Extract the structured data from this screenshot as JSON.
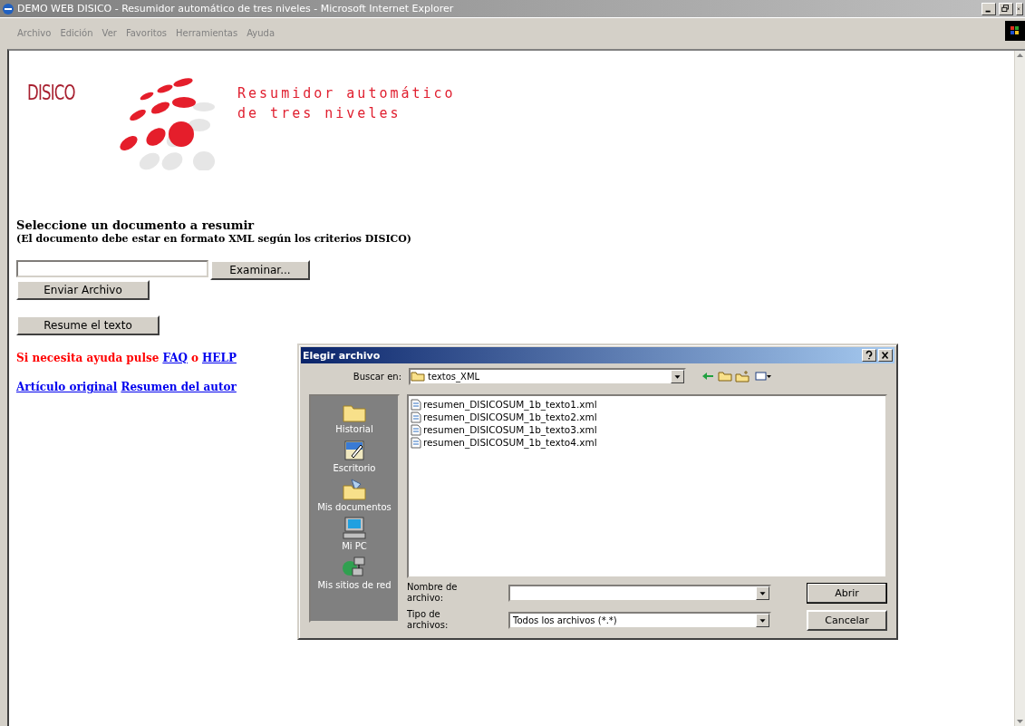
{
  "window": {
    "title": "DEMO WEB DISICO - Resumidor automático de tres niveles - Microsoft Internet Explorer"
  },
  "menu": [
    "Archivo",
    "Edición",
    "Ver",
    "Favoritos",
    "Herramientas",
    "Ayuda"
  ],
  "logo": {
    "brand": "DISICO",
    "title_lines": [
      "Resumidor automático",
      "de tres niveles"
    ]
  },
  "form": {
    "heading": "Seleccione un documento a resumir",
    "note": "(El documento debe estar en formato XML según los criterios DISICO)",
    "browse_button": "Examinar...",
    "send_button": "Enviar Archivo",
    "summarize_button": "Resume el texto"
  },
  "help": {
    "text": "Si necesita ayuda pulse",
    "faq": "FAQ",
    "or": "o",
    "help": "HELP"
  },
  "links": [
    "Artículo original",
    "Resumen del autor"
  ],
  "dialog": {
    "title": "Elegir archivo",
    "look_in_label": "Buscar en:",
    "look_in_value": "textos_XML",
    "places": [
      {
        "label": "Historial",
        "kind": "history"
      },
      {
        "label": "Escritorio",
        "kind": "desktop"
      },
      {
        "label": "Mis documentos",
        "kind": "documents"
      },
      {
        "label": "Mi PC",
        "kind": "computer"
      },
      {
        "label": "Mis sitios de red",
        "kind": "network"
      }
    ],
    "files": [
      "resumen_DISICOSUM_1b_texto1.xml",
      "resumen_DISICOSUM_1b_texto2.xml",
      "resumen_DISICOSUM_1b_texto3.xml",
      "resumen_DISICOSUM_1b_texto4.xml"
    ],
    "filename_label": "Nombre de archivo:",
    "filetype_label": "Tipo de archivos:",
    "filetype_value": "Todos los archivos (*.*)",
    "open_button": "Abrir",
    "cancel_button": "Cancelar"
  }
}
